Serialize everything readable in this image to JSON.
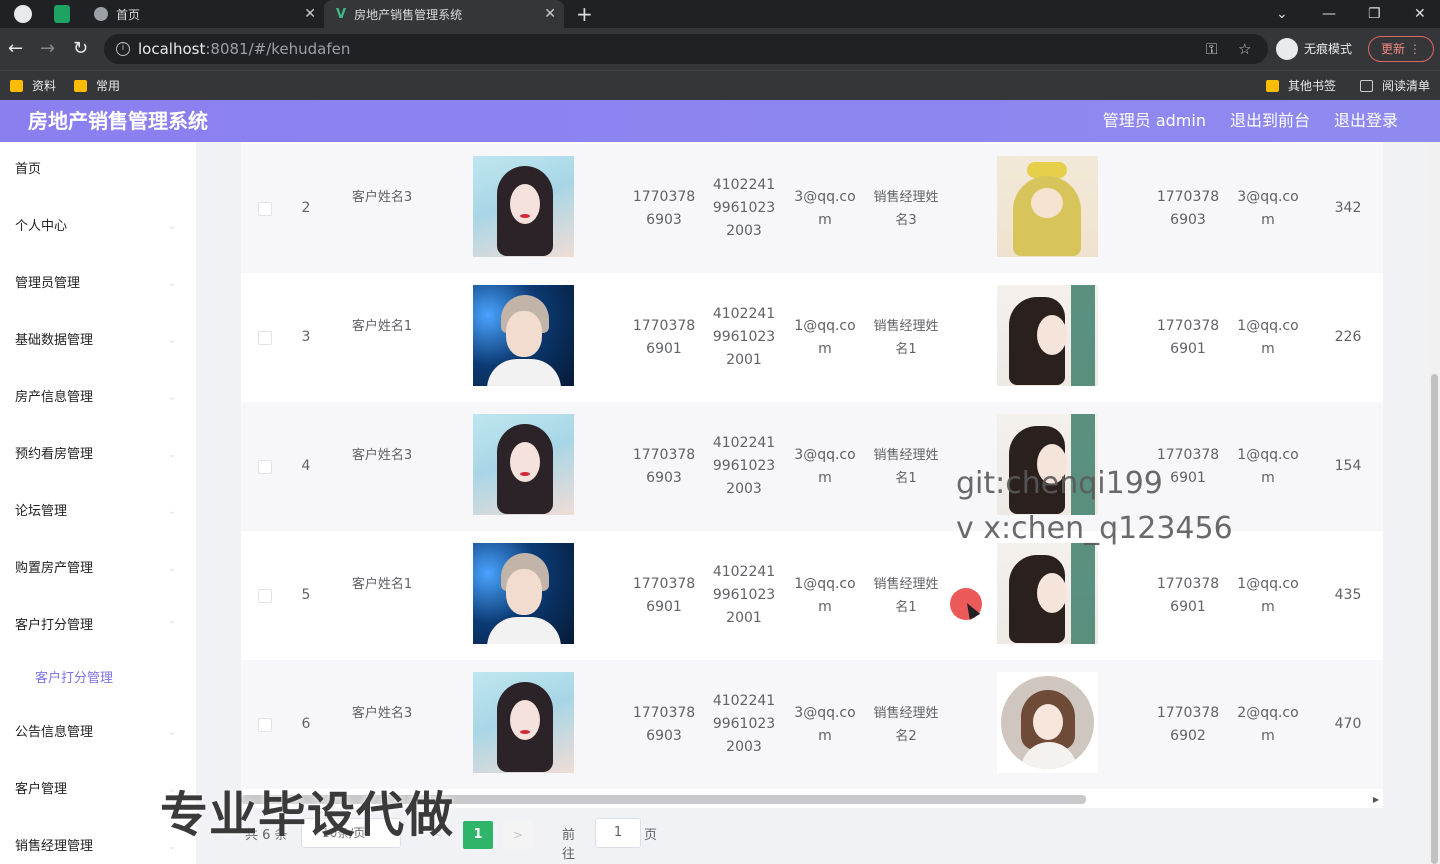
{
  "browser": {
    "tabs": [
      {
        "label": "首页"
      },
      {
        "label": "房地产销售管理系统"
      }
    ],
    "url_host": "localhost",
    "url_rest": ":8081/#/kehudafen",
    "incognito_label": "无痕模式",
    "update_label": "更新",
    "bookmarks": {
      "left": [
        "资料",
        "常用"
      ],
      "right": [
        "其他书签",
        "阅读清单"
      ]
    }
  },
  "header": {
    "title": "房地产销售管理系统",
    "admin_label": "管理员 admin",
    "to_front_label": "退出到前台",
    "logout_label": "退出登录"
  },
  "sidebar": {
    "items": [
      "首页",
      "个人中心",
      "管理员管理",
      "基础数据管理",
      "房产信息管理",
      "预约看房管理",
      "论坛管理",
      "购置房产管理",
      "客户打分管理"
    ],
    "active_submenu": "客户打分管理",
    "items_after": [
      "公告信息管理",
      "客户管理",
      "销售经理管理"
    ]
  },
  "table": {
    "rows": [
      {
        "index": "2",
        "customer_name": "客户姓名3",
        "customer_photo": "girl",
        "customer_phone": "17703786903",
        "customer_id": "410224199610232003",
        "customer_email": "3@qq.com",
        "manager_name": "销售经理姓名3",
        "manager_photo": "yellow",
        "manager_phone": "17703786903",
        "manager_email": "3@qq.com",
        "score": "342"
      },
      {
        "index": "3",
        "customer_name": "客户姓名1",
        "customer_photo": "boy",
        "customer_phone": "17703786901",
        "customer_id": "410224199610232001",
        "customer_email": "1@qq.com",
        "manager_name": "销售经理姓名1",
        "manager_photo": "brunette",
        "manager_phone": "17703786901",
        "manager_email": "1@qq.com",
        "score": "226"
      },
      {
        "index": "4",
        "customer_name": "客户姓名3",
        "customer_photo": "girl",
        "customer_phone": "17703786903",
        "customer_id": "410224199610232003",
        "customer_email": "3@qq.com",
        "manager_name": "销售经理姓名1",
        "manager_photo": "brunette",
        "manager_phone": "17703786901",
        "manager_email": "1@qq.com",
        "score": "154"
      },
      {
        "index": "5",
        "customer_name": "客户姓名1",
        "customer_photo": "boy",
        "customer_phone": "17703786901",
        "customer_id": "410224199610232001",
        "customer_email": "1@qq.com",
        "manager_name": "销售经理姓名1",
        "manager_photo": "brunette",
        "manager_phone": "17703786901",
        "manager_email": "1@qq.com",
        "score": "435"
      },
      {
        "index": "6",
        "customer_name": "客户姓名3",
        "customer_photo": "girl",
        "customer_phone": "17703786903",
        "customer_id": "410224199610232003",
        "customer_email": "3@qq.com",
        "manager_name": "销售经理姓名2",
        "manager_photo": "round",
        "manager_phone": "17703786902",
        "manager_email": "2@qq.com",
        "score": "470"
      }
    ]
  },
  "pagination": {
    "total": "共 6 条",
    "page_size": "10条/页",
    "prev": "<",
    "current": "1",
    "next": ">",
    "goto_label": "前往",
    "goto_value": "1",
    "unit": "页"
  },
  "watermarks": {
    "git": "git:chenqi199",
    "vx": "v x:chen_q123456",
    "big": "专业毕设代做"
  }
}
